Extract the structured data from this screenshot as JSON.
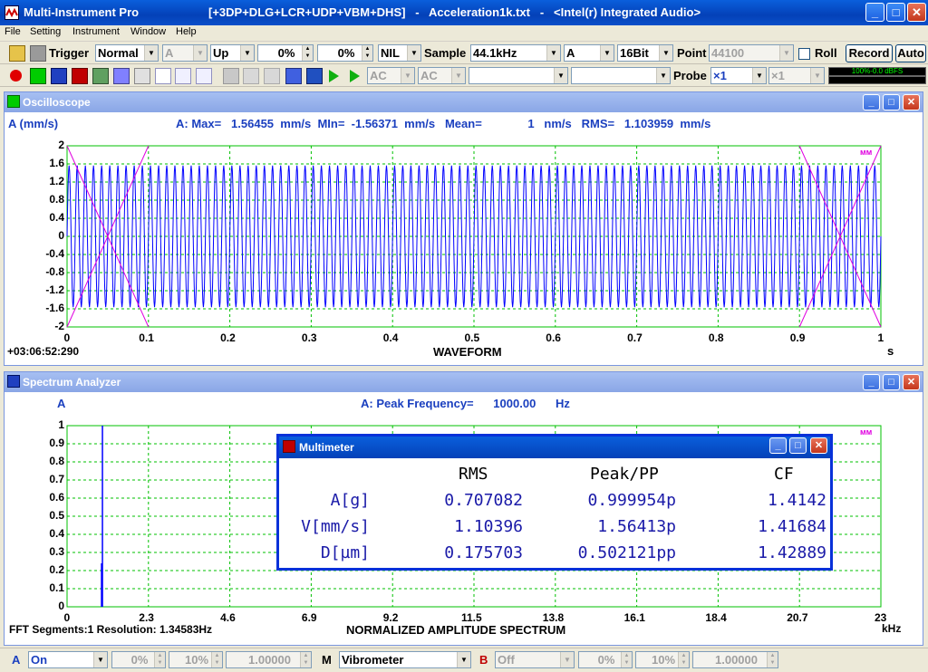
{
  "app": {
    "name": "Multi-Instrument Pro",
    "modes": "[+3DP+DLG+LCR+UDP+VBM+DHS]",
    "file": "Acceleration1k.txt",
    "device": "<Intel(r) Integrated Audio>",
    "sep": "-"
  },
  "menu": [
    "File",
    "Setting",
    "Instrument",
    "Window",
    "Help"
  ],
  "toolbar1": {
    "trigger_label": "Trigger",
    "trigger_mode": "Normal",
    "channel": "A",
    "edge": "Up",
    "level1": "0%",
    "level2": "0%",
    "nil": "NIL",
    "sample_label": "Sample",
    "sample_rate": "44.1kHz",
    "sample_ch": "A",
    "bits": "16Bit",
    "point_label": "Point",
    "points": "44100",
    "roll_label": "Roll",
    "record": "Record",
    "auto": "Auto"
  },
  "toolbar2": {
    "ac1": "AC",
    "ac2": "AC",
    "probe_label": "Probe",
    "probe1": "×1",
    "probe2": "×1",
    "level_meter": "100%-0.0 dBFS"
  },
  "osc": {
    "title": "Oscilloscope",
    "channel_unit": "A (mm/s)",
    "stats": "A: Max=   1.56455  mm/s  MIn=  -1.56371  mm/s   Mean=              1   nm/s   RMS=   1.103959  mm/s",
    "timestamp": "+03:06:52:290",
    "xlabel": "WAVEFORM",
    "xunit": "s",
    "yticks": [
      "2",
      "1.6",
      "1.2",
      "0.8",
      "0.4",
      "0",
      "-0.4",
      "-0.8",
      "-1.2",
      "-1.6",
      "-2"
    ],
    "xticks": [
      "0",
      "0.1",
      "0.2",
      "0.3",
      "0.4",
      "0.5",
      "0.6",
      "0.7",
      "0.8",
      "0.9",
      "1"
    ],
    "cycles": 100,
    "amplitude": 1.5645
  },
  "spec": {
    "title": "Spectrum Analyzer",
    "channel": "A",
    "peak": "A: Peak Frequency=      1000.00      Hz",
    "footer_left": "FFT Segments:1   Resolution: 1.34583Hz",
    "xlabel": "NORMALIZED AMPLITUDE SPECTRUM",
    "xunit": "kHz",
    "yticks": [
      "1",
      "0.9",
      "0.8",
      "0.7",
      "0.6",
      "0.5",
      "0.4",
      "0.3",
      "0.2",
      "0.1",
      "0"
    ],
    "xticks": [
      "0",
      "2.3",
      "4.6",
      "6.9",
      "9.2",
      "11.5",
      "13.8",
      "16.1",
      "18.4",
      "20.7",
      "23"
    ],
    "peak_khz": 1.0,
    "peak_value": 1.0,
    "side_value": 0.24
  },
  "multimeter": {
    "title": "Multimeter",
    "headers": [
      "RMS",
      "Peak/PP",
      "CF"
    ],
    "rows": [
      {
        "label": "A[g]",
        "rms": "0.707082",
        "peak": "0.999954p",
        "cf": "1.4142"
      },
      {
        "label": "V[mm/s]",
        "rms": "1.10396",
        "peak": "1.56413p",
        "cf": "1.41684"
      },
      {
        "label": "D[µm]",
        "rms": "0.175703",
        "peak": "0.502121pp",
        "cf": "1.42889"
      }
    ]
  },
  "status": {
    "a_label": "A",
    "a_state": "On",
    "a_p1": "0%",
    "a_p2": "10%",
    "a_gain": "1.00000",
    "m_label": "M",
    "m_mode": "Vibrometer",
    "b_label": "B",
    "b_state": "Off",
    "b_p1": "0%",
    "b_p2": "10%",
    "b_gain": "1.00000"
  },
  "colors": {
    "trace": "#0000ff",
    "window_fn": "#e000e0",
    "grid": "#00c000",
    "header": "#1a3fbf"
  }
}
